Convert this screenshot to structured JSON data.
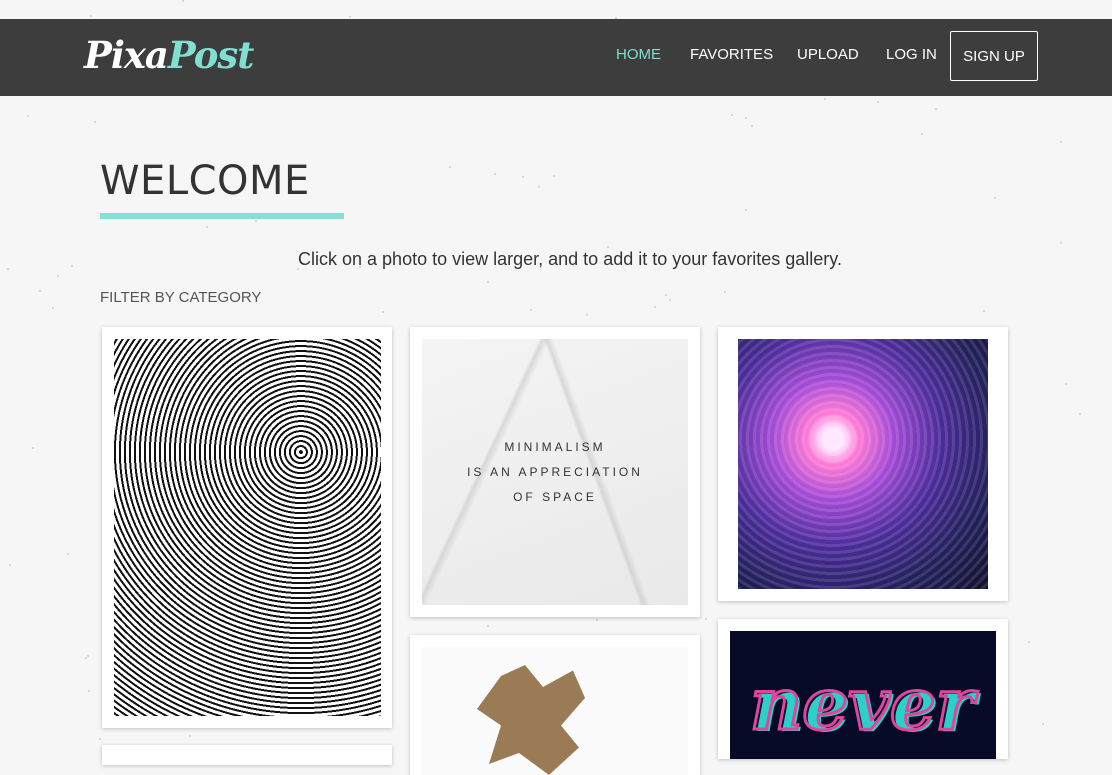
{
  "brand": {
    "part1": "Pixa",
    "part2": "Post"
  },
  "nav": {
    "home": "HOME",
    "favorites": "FAVORITES",
    "upload": "UPLOAD",
    "login": "LOG IN",
    "signup": "SIGN UP"
  },
  "colors": {
    "accent": "#7fdfd0",
    "navbar": "#3d3d3d"
  },
  "page": {
    "title": "WELCOME",
    "intro": "Click on a photo to view larger, and to add it to your favorites gallery.",
    "filter_label": "FILTER BY CATEGORY"
  },
  "gallery": {
    "marble_quote": [
      "MINIMALISM",
      "IS AN APPRECIATION",
      "OF SPACE"
    ],
    "neon_word": "never"
  }
}
